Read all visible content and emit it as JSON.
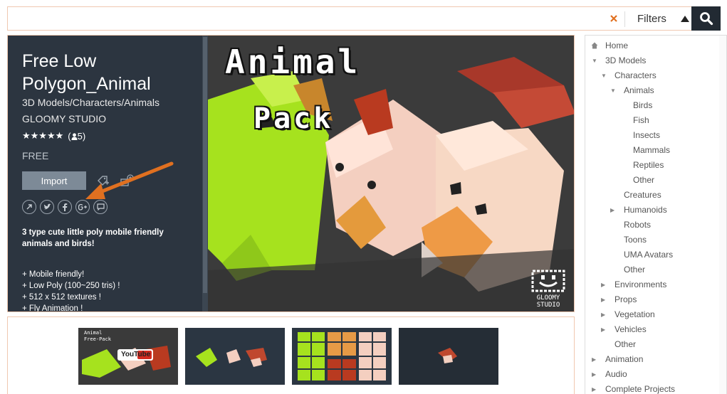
{
  "search": {
    "value": "",
    "placeholder": "",
    "filters_label": "Filters"
  },
  "product": {
    "title": "Free Low Polygon_Animal",
    "category": "3D Models/Characters/Animals",
    "publisher": "GLOOMY STUDIO",
    "stars": "★★★★★",
    "rating_count": "5",
    "price": "FREE",
    "import_label": "Import",
    "description": "3 type cute little poly mobile friendly animals and birds!",
    "features": [
      "+ Mobile friendly!",
      "+ Low Poly (100~250 tris) !",
      "+ 512 x 512 textures !",
      "+ Fly Animation !"
    ]
  },
  "hero": {
    "line1": "Animal",
    "line2": "Pack",
    "studio": "GLOOMY STUDIO"
  },
  "thumbnails": [
    {
      "caption1": "Animal",
      "caption2": "Free-Pack",
      "overlay": "YouTube"
    },
    {
      "caption1": "",
      "caption2": "",
      "overlay": ""
    },
    {
      "caption1": "",
      "caption2": "",
      "overlay": ""
    },
    {
      "caption1": "",
      "caption2": "",
      "overlay": ""
    }
  ],
  "sidebar": {
    "items": [
      {
        "label": "Home",
        "level": 0,
        "icon": "home-icon"
      },
      {
        "label": "3D Models",
        "level": 0,
        "icon": "expanded"
      },
      {
        "label": "Characters",
        "level": 1,
        "icon": "expanded"
      },
      {
        "label": "Animals",
        "level": 2,
        "icon": "expanded"
      },
      {
        "label": "Birds",
        "level": 3
      },
      {
        "label": "Fish",
        "level": 3
      },
      {
        "label": "Insects",
        "level": 3
      },
      {
        "label": "Mammals",
        "level": 3
      },
      {
        "label": "Reptiles",
        "level": 3
      },
      {
        "label": "Other",
        "level": 3
      },
      {
        "label": "Creatures",
        "level": 2
      },
      {
        "label": "Humanoids",
        "level": 2,
        "icon": "collapsed"
      },
      {
        "label": "Robots",
        "level": 2
      },
      {
        "label": "Toons",
        "level": 2
      },
      {
        "label": "UMA Avatars",
        "level": 2
      },
      {
        "label": "Other",
        "level": 2
      },
      {
        "label": "Environments",
        "level": 1,
        "icon": "collapsed"
      },
      {
        "label": "Props",
        "level": 1,
        "icon": "collapsed"
      },
      {
        "label": "Vegetation",
        "level": 1,
        "icon": "collapsed"
      },
      {
        "label": "Vehicles",
        "level": 1,
        "icon": "collapsed"
      },
      {
        "label": "Other",
        "level": 1
      },
      {
        "label": "Animation",
        "level": 0,
        "icon": "collapsed"
      },
      {
        "label": "Audio",
        "level": 0,
        "icon": "collapsed"
      },
      {
        "label": "Complete Projects",
        "level": 0,
        "icon": "collapsed"
      }
    ]
  },
  "colors": {
    "accent": "#e07020",
    "panel": "#2c3540",
    "search_button": "#222a33"
  }
}
